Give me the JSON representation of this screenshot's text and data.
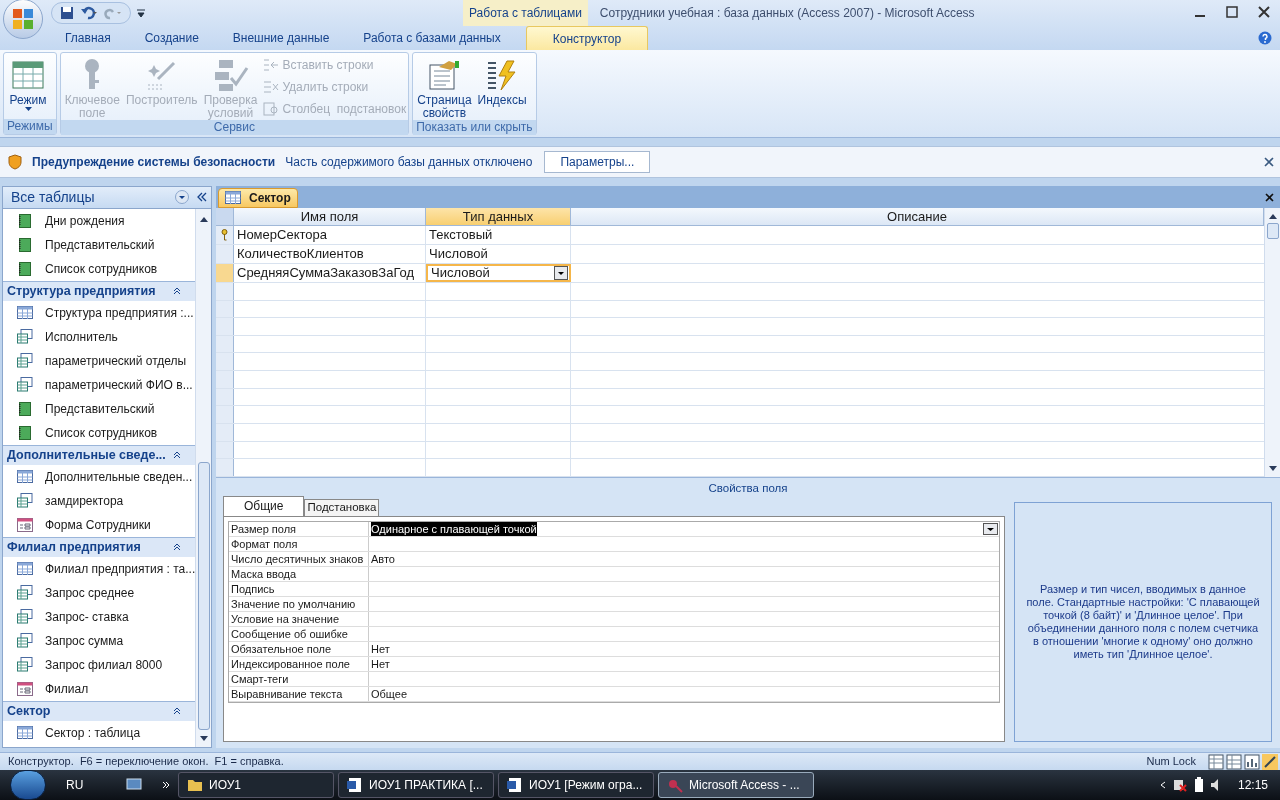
{
  "window": {
    "context_tab": "Работа с таблицами",
    "title": "Сотрудники учебная : база данных (Access 2007) - Microsoft Access"
  },
  "ribbon_tabs": [
    {
      "label": "Главная",
      "selected": false
    },
    {
      "label": "Создание",
      "selected": false
    },
    {
      "label": "Внешние данные",
      "selected": false
    },
    {
      "label": "Работа с базами данных",
      "selected": false
    },
    {
      "label": "Конструктор",
      "selected": true
    }
  ],
  "ribbon_groups": [
    {
      "title": "Режимы",
      "buttons": [
        {
          "kind": "large",
          "label": "Режим",
          "disabled": false
        }
      ]
    },
    {
      "title": "Сервис",
      "buttons": [
        {
          "kind": "large",
          "label": "Ключевое поле",
          "disabled": true
        },
        {
          "kind": "large",
          "label": "Построитель",
          "disabled": true
        },
        {
          "kind": "large",
          "label": "Проверка условий",
          "disabled": true
        },
        {
          "kind": "small",
          "label": "Вставить строки",
          "disabled": true
        },
        {
          "kind": "small",
          "label": "Удалить строки",
          "disabled": true
        },
        {
          "kind": "small",
          "label": "Столбец  подстановок",
          "disabled": true
        }
      ]
    },
    {
      "title": "Показать или скрыть",
      "buttons": [
        {
          "kind": "large",
          "label": "Страница свойств",
          "disabled": false
        },
        {
          "kind": "large",
          "label": "Индексы",
          "disabled": false
        }
      ]
    }
  ],
  "security_bar": {
    "title": "Предупреждение системы безопасности",
    "message": "Часть содержимого базы данных отключено",
    "button": "Параметры..."
  },
  "navigation": {
    "title": "Все таблицы",
    "groups": [
      {
        "items": [
          {
            "kind": "report",
            "label": "Дни рождения"
          },
          {
            "kind": "report",
            "label": "Представительский"
          },
          {
            "kind": "report",
            "label": "Список сотрудников"
          }
        ]
      },
      {
        "title": "Структура предприятия",
        "items": [
          {
            "kind": "table",
            "label": "Структура предприятия :..."
          },
          {
            "kind": "query",
            "label": "Исполнитель"
          },
          {
            "kind": "query",
            "label": "параметрический отделы"
          },
          {
            "kind": "query",
            "label": "параметрический ФИО в..."
          },
          {
            "kind": "report",
            "label": "Представительский"
          },
          {
            "kind": "report",
            "label": "Список сотрудников"
          }
        ]
      },
      {
        "title": "Дополнительные сведе...",
        "items": [
          {
            "kind": "table",
            "label": "Дополнительные сведен..."
          },
          {
            "kind": "query",
            "label": "замдиректора"
          },
          {
            "kind": "form",
            "label": "Форма Сотрудники"
          }
        ]
      },
      {
        "title": "Филиал предприятия",
        "items": [
          {
            "kind": "table",
            "label": "Филиал предприятия : та..."
          },
          {
            "kind": "query",
            "label": "Запрос среднее"
          },
          {
            "kind": "query",
            "label": "Запрос- ставка"
          },
          {
            "kind": "query",
            "label": "Запрос сумма"
          },
          {
            "kind": "query",
            "label": "Запрос филиал 8000"
          },
          {
            "kind": "form",
            "label": "Филиал"
          }
        ]
      },
      {
        "title": "Сектор",
        "items": [
          {
            "kind": "table",
            "label": "Сектор : таблица"
          }
        ]
      }
    ]
  },
  "document_tab": {
    "label": "Сектор"
  },
  "design_grid": {
    "columns": [
      "Имя поля",
      "Тип данных",
      "Описание"
    ],
    "rows": [
      {
        "name": "НомерСектора",
        "type": "Текстовый",
        "primary_key": true,
        "selected": false
      },
      {
        "name": "КоличествоКлиентов",
        "type": "Числовой",
        "primary_key": false,
        "selected": false
      },
      {
        "name": "СредняяСуммаЗаказовЗаГод",
        "type": "Числовой",
        "primary_key": false,
        "selected": true
      }
    ]
  },
  "field_properties": {
    "title": "Свойства поля",
    "tabs": [
      {
        "label": "Общие",
        "selected": true
      },
      {
        "label": "Подстановка",
        "selected": false
      }
    ],
    "rows": [
      {
        "label": "Размер поля",
        "value": "Одинарное с плавающей точкой",
        "selected": true
      },
      {
        "label": "Формат поля",
        "selected": false
      },
      {
        "label": "Число десятичных знаков",
        "value": "Авто",
        "selected": false
      },
      {
        "label": "Маска ввода",
        "selected": false
      },
      {
        "label": "Подпись",
        "selected": false
      },
      {
        "label": "Значение по умолчанию",
        "selected": false
      },
      {
        "label": "Условие на значение",
        "selected": false
      },
      {
        "label": "Сообщение об ошибке",
        "selected": false
      },
      {
        "label": "Обязательное поле",
        "value": "Нет",
        "selected": false
      },
      {
        "label": "Индексированное поле",
        "value": "Нет",
        "selected": false
      },
      {
        "label": "Смарт-теги",
        "selected": false
      },
      {
        "label": "Выравнивание текста",
        "value": "Общее",
        "selected": false
      }
    ],
    "help": "Размер и тип чисел, вводимых в данное поле.  Стандартные настройки: 'С плавающей точкой (8 байт)' и 'Длинное целое'.  При объединении данного поля с полем счетчика в отношении 'многие к одному' оно должно иметь тип 'Длинное целое'."
  },
  "status_bar": {
    "text": "Конструктор.  F6 = переключение окон.  F1 = справка.",
    "indicator": "Num Lock"
  },
  "taskbar": {
    "language": "RU",
    "items": [
      {
        "kind": "folder",
        "label": "ИОУ1",
        "selected": false
      },
      {
        "kind": "word",
        "label": "ИОУ1 ПРАКТИКА [...",
        "selected": false
      },
      {
        "kind": "word",
        "label": "ИОУ1 [Режим огра...",
        "selected": false
      },
      {
        "kind": "access",
        "label": "Microsoft Access - ...",
        "selected": true
      }
    ],
    "time": "12:15"
  }
}
